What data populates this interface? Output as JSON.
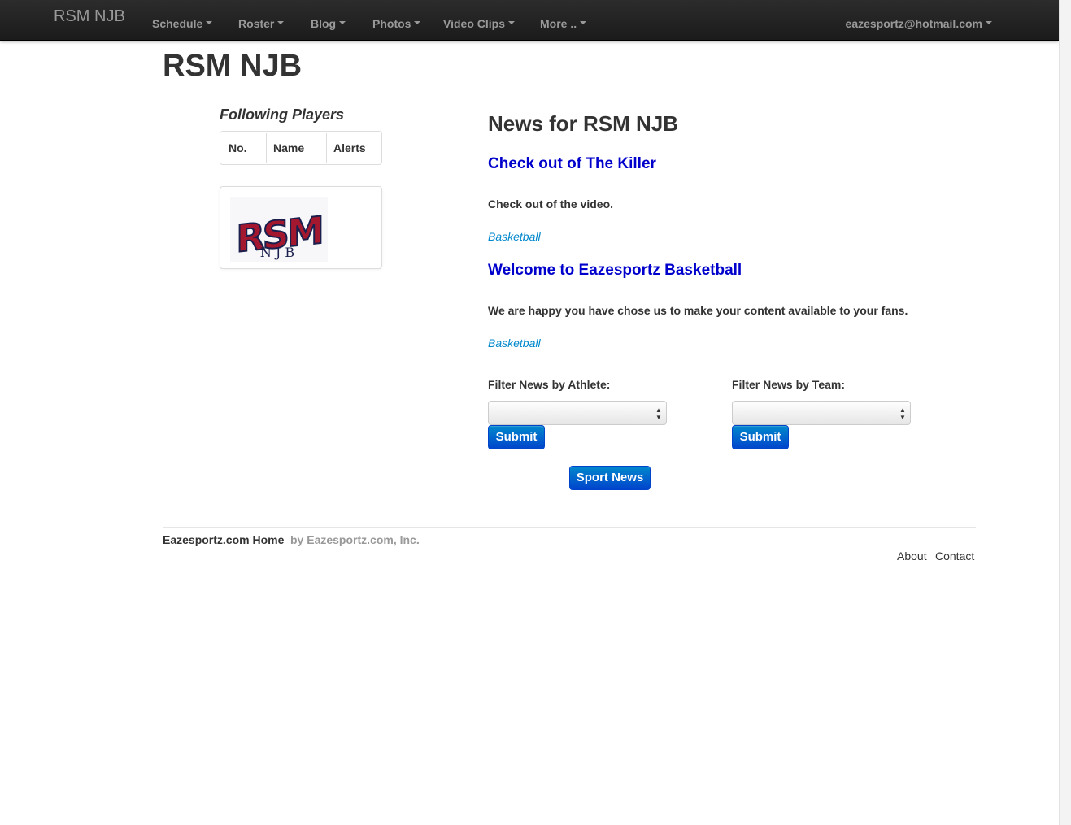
{
  "navbar": {
    "brand": "RSM NJB",
    "items": [
      {
        "label": "Schedule"
      },
      {
        "label": "Roster"
      },
      {
        "label": "Blog"
      },
      {
        "label": "Photos"
      },
      {
        "label": "Video Clips"
      },
      {
        "label": "More .."
      }
    ],
    "user": "eazesportz@hotmail.com"
  },
  "page": {
    "title": "RSM NJB"
  },
  "sidebar": {
    "following_title": "Following Players",
    "table_headers": [
      "No.",
      "Name",
      "Alerts"
    ],
    "logo": {
      "letters": "RSM",
      "subtext": "N J B",
      "color": "#a3182f"
    }
  },
  "news": {
    "heading": "News for RSM NJB",
    "articles": [
      {
        "title": "Check out of The Killer",
        "body": "Check out of the video.",
        "tag": "Basketball"
      },
      {
        "title": "Welcome to Eazesportz Basketball",
        "body": "We are happy you have chose us to make your content available to your fans.",
        "tag": "Basketball"
      }
    ],
    "filter_athlete": {
      "label": "Filter News by Athlete:",
      "selected": "",
      "submit": "Submit"
    },
    "filter_team": {
      "label": "Filter News by Team:",
      "selected": "",
      "submit": "Submit"
    },
    "sport_news_button": "Sport News"
  },
  "footer": {
    "home": "Eazesportz.com Home",
    "by": "by Eazesportz.com, Inc.",
    "links": [
      "About",
      "Contact"
    ]
  },
  "colors": {
    "link_title": "#0000cc",
    "tag": "#0088cc",
    "button": "#0066cc"
  }
}
